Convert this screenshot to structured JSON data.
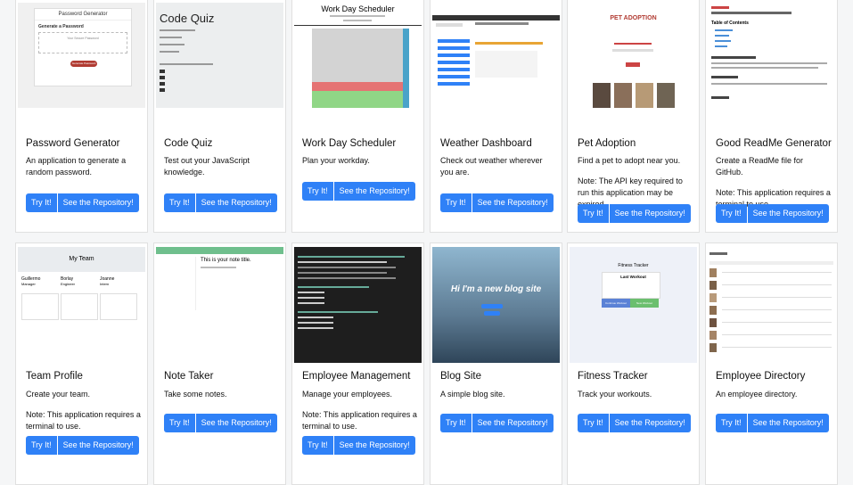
{
  "projects": [
    {
      "title": "Password Generator",
      "desc": "An application to generate a random password.",
      "note": "",
      "try": "Try It!",
      "repo": "See the Repository!",
      "thumb": {
        "heading": "Password Generator",
        "sub": "Generate a Password",
        "placeholder": "Your Secure Password",
        "button": "Generate Password"
      }
    },
    {
      "title": "Code Quiz",
      "desc": "Test out your JavaScript knowledge.",
      "note": "",
      "try": "Try It!",
      "repo": "See the Repository!",
      "thumb": {
        "heading": "Code Quiz"
      }
    },
    {
      "title": "Work Day Scheduler",
      "desc": "Plan your workday.",
      "note": "",
      "try": "Try It!",
      "repo": "See the Repository!",
      "thumb": {
        "heading": "Work Day Scheduler"
      }
    },
    {
      "title": "Weather Dashboard",
      "desc": "Check out weather wherever you are.",
      "note": "",
      "try": "Try It!",
      "repo": "See the Repository!",
      "thumb": {
        "heading": "Weather Dashboard"
      }
    },
    {
      "title": "Pet Adoption",
      "desc": "Find a pet to adopt near you.",
      "note": "Note: The API key required to run this application may be expired.",
      "try": "Try It!",
      "repo": "See the Repository!",
      "thumb": {
        "heading": "PET ADOPTION"
      }
    },
    {
      "title": "Good ReadMe Generator",
      "desc": "Create a ReadMe file for GitHub.",
      "note": "Note: This application requires a terminal to use.",
      "try": "Try It!",
      "repo": "See the Repository!",
      "thumb": {
        "heading": "Table of Contents"
      }
    },
    {
      "title": "Team Profile",
      "desc": "Create your team.",
      "note": "Note: This application requires a terminal to use.",
      "try": "Try It!",
      "repo": "See the Repository!",
      "thumb": {
        "heading": "My Team",
        "people": [
          "Guillermo",
          "Borlay",
          "Joanne"
        ],
        "roles": [
          "Manager",
          "Engineer",
          "Intern"
        ]
      }
    },
    {
      "title": "Note Taker",
      "desc": "Take some notes.",
      "note": "",
      "try": "Try It!",
      "repo": "See the Repository!",
      "thumb": {
        "heading": "This is your note title."
      }
    },
    {
      "title": "Employee Management",
      "desc": "Manage your employees.",
      "note": "Note: This application requires a terminal to use.",
      "try": "Try It!",
      "repo": "See the Repository!",
      "thumb": {
        "heading": ""
      }
    },
    {
      "title": "Blog Site",
      "desc": "A simple blog site.",
      "note": "",
      "try": "Try It!",
      "repo": "See the Repository!",
      "thumb": {
        "heading": "Hi I'm a new blog site"
      }
    },
    {
      "title": "Fitness Tracker",
      "desc": "Track your workouts.",
      "note": "",
      "try": "Try It!",
      "repo": "See the Repository!",
      "thumb": {
        "heading": "Fitness Tracker",
        "sub": "Last Workout",
        "b1": "Continue Workout",
        "b2": "New Workout"
      }
    },
    {
      "title": "Employee Directory",
      "desc": "An employee directory.",
      "note": "",
      "try": "Try It!",
      "repo": "See the Repository!",
      "thumb": {
        "heading": ""
      }
    }
  ],
  "colors": {
    "primary": "#2f81f7",
    "scheduler_past": "#d3d3d3",
    "scheduler_present": "#e57373",
    "scheduler_future": "#90d686"
  }
}
